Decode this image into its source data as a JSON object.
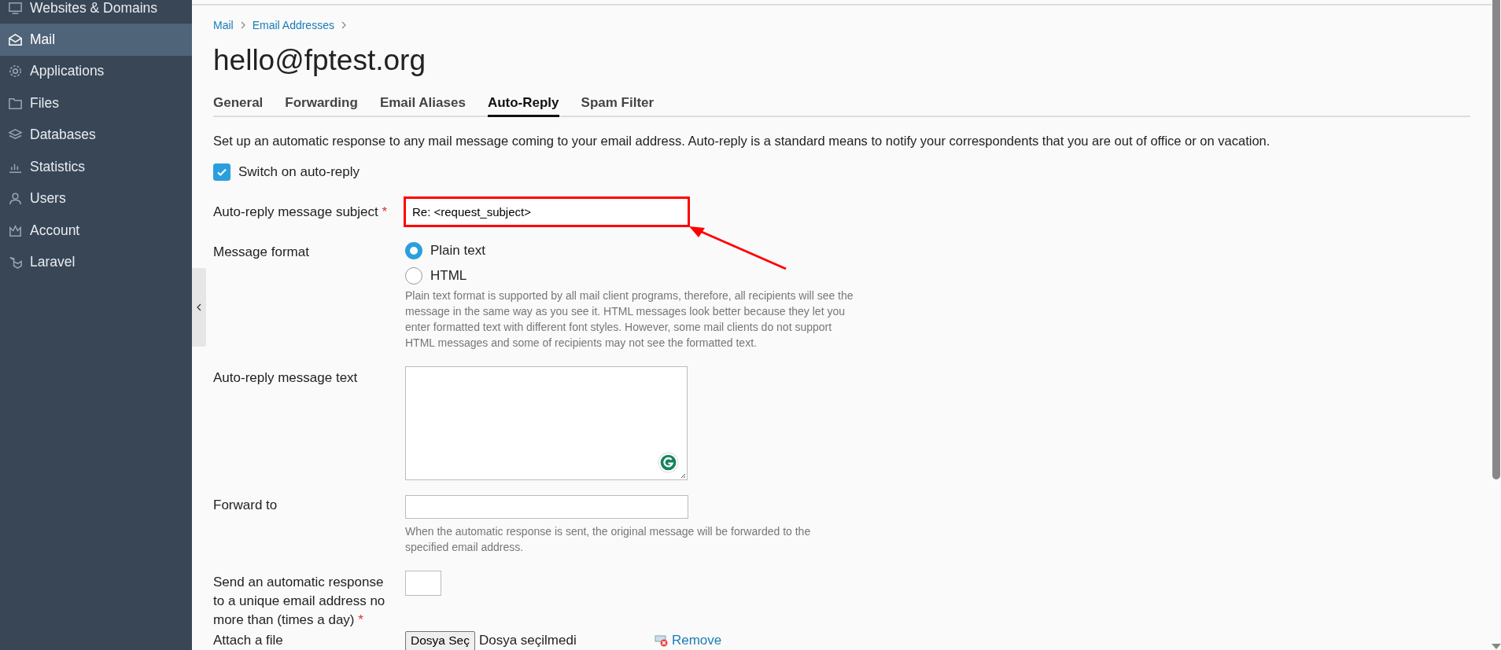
{
  "sidebar": {
    "items": [
      {
        "label": "Websites & Domains",
        "selected": false
      },
      {
        "label": "Mail",
        "selected": true
      },
      {
        "label": "Applications",
        "selected": false
      },
      {
        "label": "Files",
        "selected": false
      },
      {
        "label": "Databases",
        "selected": false
      },
      {
        "label": "Statistics",
        "selected": false
      },
      {
        "label": "Users",
        "selected": false
      },
      {
        "label": "Account",
        "selected": false
      },
      {
        "label": "Laravel",
        "selected": false
      }
    ]
  },
  "breadcrumb": [
    "Mail",
    "Email Addresses"
  ],
  "title": "hello@fptest.org",
  "tabs": [
    {
      "label": "General",
      "selected": false
    },
    {
      "label": "Forwarding",
      "selected": false
    },
    {
      "label": "Email Aliases",
      "selected": false
    },
    {
      "label": "Auto-Reply",
      "selected": true
    },
    {
      "label": "Spam Filter",
      "selected": false
    }
  ],
  "description": "Set up an automatic response to any mail message coming to your email address. Auto-reply is a standard means to notify your correspondents that you are out of office or on vacation.",
  "switch": {
    "label": "Switch on auto-reply",
    "checked": true
  },
  "subject": {
    "label": "Auto-reply message subject",
    "required_mark": "*",
    "value": "Re: <request_subject>",
    "highlighted": true
  },
  "format": {
    "label": "Message format",
    "options": [
      {
        "label": "Plain text",
        "selected": true
      },
      {
        "label": "HTML",
        "selected": false
      }
    ],
    "help": "Plain text format is supported by all mail client programs, therefore, all recipients will see the message in the same way as you see it. HTML messages look better because they let you enter formatted text with different font styles. However, some mail clients do not support HTML messages and some of recipients may not see the formatted text."
  },
  "message_text": {
    "label": "Auto-reply message text"
  },
  "forward_to": {
    "label": "Forward to",
    "help": "When the automatic response is sent, the original message will be forwarded to the specified email address."
  },
  "limit": {
    "label": "Send an automatic response to a unique email address no more than (times a day)",
    "required_mark": "*"
  },
  "attach": {
    "label": "Attach a file",
    "button": "Dosya Seç",
    "status": "Dosya seçilmedi",
    "remove": "Remove"
  }
}
